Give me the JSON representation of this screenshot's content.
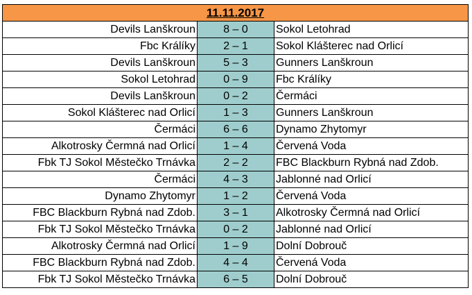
{
  "header": {
    "date": "11.11.2017"
  },
  "colors": {
    "header_bg": "#f79646",
    "score_bg": "#9fcdcd"
  },
  "matches": [
    {
      "home": "Devils Lanškroun",
      "score": "8 – 0",
      "away": "Sokol Letohrad"
    },
    {
      "home": "Fbc Králíky",
      "score": "2 – 1",
      "away": "Sokol Klášterec nad Orlicí"
    },
    {
      "home": "Devils Lanškroun",
      "score": "5 – 3",
      "away": "Gunners Lanškroun"
    },
    {
      "home": "Sokol Letohrad",
      "score": "0 – 9",
      "away": "Fbc Králíky"
    },
    {
      "home": "Devils Lanškroun",
      "score": "0 – 2",
      "away": "Čermáci"
    },
    {
      "home": "Sokol Klášterec nad Orlicí",
      "score": "1 – 3",
      "away": "Gunners Lanškroun"
    },
    {
      "home": "Čermáci",
      "score": "6 – 6",
      "away": "Dynamo Zhytomyr"
    },
    {
      "home": "Alkotrosky Čermná nad Orlicí",
      "score": "1 – 4",
      "away": "Červená Voda"
    },
    {
      "home": "Fbk TJ Sokol Městečko Trnávka",
      "score": "2 – 2",
      "away": "FBC Blackburn Rybná nad Zdob."
    },
    {
      "home": "Čermáci",
      "score": "4 – 3",
      "away": "Jablonné nad Orlicí"
    },
    {
      "home": "Dynamo Zhytomyr",
      "score": "1 – 2",
      "away": "Červená Voda"
    },
    {
      "home": "FBC Blackburn Rybná nad Zdob.",
      "score": "3 – 1",
      "away": "Alkotrosky Čermná nad Orlicí"
    },
    {
      "home": "Fbk TJ Sokol Městečko Trnávka",
      "score": "0 – 2",
      "away": "Jablonné nad Orlicí"
    },
    {
      "home": "Alkotrosky Čermná nad Orlicí",
      "score": "1 – 9",
      "away": "Dolní Dobrouč"
    },
    {
      "home": "FBC Blackburn Rybná nad Zdob.",
      "score": "4 – 4",
      "away": "Červená Voda"
    },
    {
      "home": "Fbk TJ Sokol Městečko Trnávka",
      "score": "6 – 5",
      "away": "Dolní Dobrouč"
    }
  ]
}
